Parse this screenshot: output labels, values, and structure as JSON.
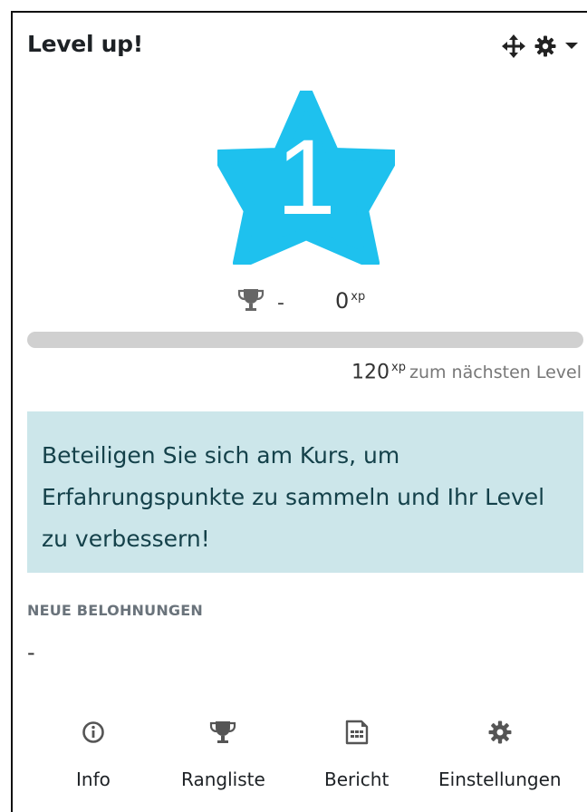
{
  "block": {
    "title": "Level up!",
    "controls": {
      "move_icon": "move-icon",
      "settings_icon": "gear-icon",
      "dropdown_icon": "caret-down-icon"
    }
  },
  "level": {
    "number": "1",
    "star_color": "#1ec1ee"
  },
  "rank": {
    "icon": "trophy-icon",
    "value": "-"
  },
  "xp": {
    "current": "0",
    "unit": "xp"
  },
  "progress": {
    "fraction": 0.0,
    "fill_color": "#0f6cbf"
  },
  "next_level": {
    "xp": "120",
    "unit": "xp",
    "label": "zum nächsten Level"
  },
  "notice": {
    "text": "Beteiligen Sie sich am Kurs, um Erfahrungspunkte zu sammeln und Ihr Level zu verbessern!"
  },
  "rewards": {
    "heading": "NEUE BELOHNUNGEN",
    "value": "-"
  },
  "nav": {
    "items": [
      {
        "label": "Info",
        "icon": "info-icon"
      },
      {
        "label": "Rangliste",
        "icon": "trophy-icon"
      },
      {
        "label": "Bericht",
        "icon": "report-icon"
      },
      {
        "label": "Einstellungen",
        "icon": "gear-icon"
      }
    ]
  }
}
